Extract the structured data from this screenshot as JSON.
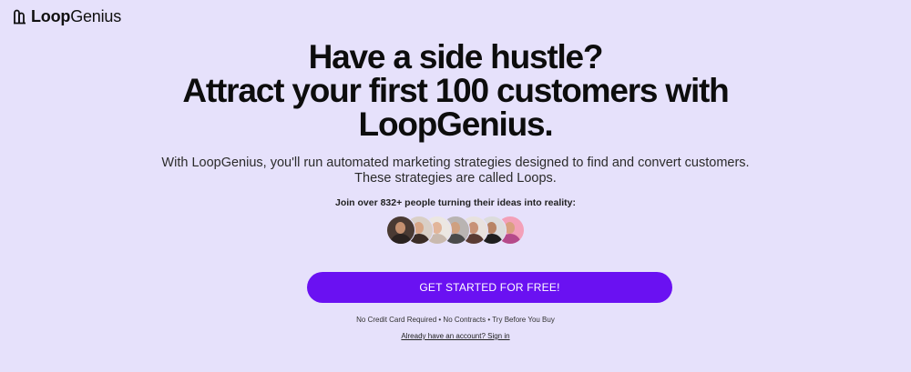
{
  "brand": {
    "name_bold": "Loop",
    "name_regular": "Genius",
    "logo_icon": "loop-logo-icon"
  },
  "hero": {
    "headline_line1": "Have a side hustle?",
    "headline_line2": "Attract your first 100 customers with",
    "headline_line3": "LoopGenius.",
    "subtitle": "With LoopGenius, you'll run automated marketing strategies designed to find and convert customers. These strategies are called Loops.",
    "join_text": "Join over 832+ people turning their ideas into reality:"
  },
  "avatars": [
    {
      "bg": "#4a3a33",
      "skin": "#c49070",
      "shirt": "#2a2220"
    },
    {
      "bg": "#d9cfc6",
      "skin": "#d8a585",
      "shirt": "#3b2c26"
    },
    {
      "bg": "#ece7e2",
      "skin": "#e2b59a",
      "shirt": "#c9b9ae"
    },
    {
      "bg": "#b9b4b2",
      "skin": "#cfa080",
      "shirt": "#4a4a4a"
    },
    {
      "bg": "#e8e2de",
      "skin": "#c89277",
      "shirt": "#5a3b33"
    },
    {
      "bg": "#dcdcdc",
      "skin": "#b88465",
      "shirt": "#1f1f1f"
    },
    {
      "bg": "#f3a0b8",
      "skin": "#d9a080",
      "shirt": "#b54a8a"
    }
  ],
  "cta": {
    "label": "GET STARTED FOR FREE!",
    "color": "#6a11f2"
  },
  "perks": "No Credit Card Required • No Contracts • Try Before You Buy",
  "signin": "Already have an account? Sign in",
  "colors": {
    "background": "#e6e1fb",
    "accent": "#6a11f2"
  }
}
